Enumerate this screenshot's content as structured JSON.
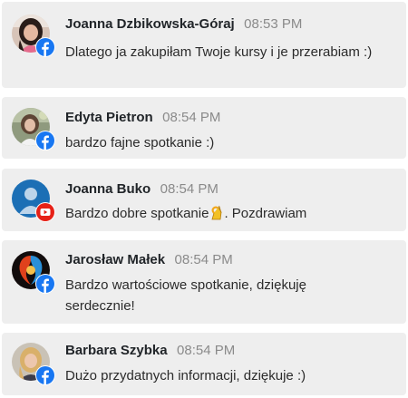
{
  "comments": [
    {
      "author": "Joanna Dzbikowska-Góraj",
      "time": "08:53 PM",
      "message": "Dlatego ja zakupiłam Twoje kursy i je przerabiam :)",
      "platform": "facebook",
      "avatar": "photo-woman-dark-hair"
    },
    {
      "author": "Edyta Pietron",
      "time": "08:54 PM",
      "message": "bardzo fajne spotkanie :)",
      "platform": "facebook",
      "avatar": "photo-woman-outdoor"
    },
    {
      "author": "Joanna Buko",
      "time": "08:54 PM",
      "message_before_emoji": "Bardzo dobre spotkanie",
      "message_after_emoji": ". Pozdrawiam",
      "emoji": "ok-hand-emoji",
      "platform": "youtube",
      "avatar": "default-user-silhouette"
    },
    {
      "author": "Jarosław Małek",
      "time": "08:54 PM",
      "message": "Bardzo wartościowe spotkanie, dziękuję serdecznie!",
      "platform": "facebook",
      "avatar": "fire-ice-emblem"
    },
    {
      "author": "Barbara Szybka",
      "time": "08:54 PM",
      "message": "Dużo przydatnych informacji, dziękuje :)",
      "platform": "facebook",
      "avatar": "photo-woman-blonde"
    }
  ],
  "colors": {
    "card_background": "#eeeeee",
    "author": "#212529",
    "timestamp": "#8a8a8a",
    "message": "#2b2b2b",
    "facebook": "#1877f2",
    "youtube": "#e62117",
    "default_avatar": "#1c6fb5"
  }
}
